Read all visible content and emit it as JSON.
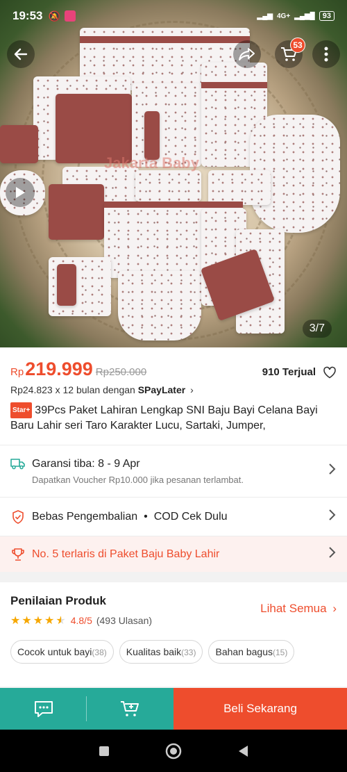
{
  "status_bar": {
    "time": "19:53",
    "battery": "93",
    "network": "4G+"
  },
  "product_image": {
    "counter": "3/7",
    "watermark": "Jakarta Baby"
  },
  "cart": {
    "badge_count": "53"
  },
  "price": {
    "currency": "Rp",
    "current": "219.999",
    "original": "Rp250.000",
    "sold": "910 Terjual",
    "paylater": "Rp24.823 x 12 bulan dengan",
    "paylater_brand": "SPayLater"
  },
  "title": {
    "badge": "Star+",
    "text": "39Pcs Paket Lahiran Lengkap SNI Baju Bayi Celana Bayi Baru Lahir seri Taro Karakter Lucu, Sartaki, Jumper,"
  },
  "shipping": {
    "label": "Garansi tiba: 8 - 9 Apr",
    "sub": "Dapatkan Voucher Rp10.000 jika pesanan terlambat."
  },
  "returns": {
    "label": "Bebas Pengembalian",
    "separator": "•",
    "cod": "COD Cek Dulu"
  },
  "bestseller": {
    "label": "No. 5 terlaris di Paket Baju Baby Lahir"
  },
  "reviews": {
    "title": "Penilaian Produk",
    "rating": "4.8/5",
    "count": "(493 Ulasan)",
    "see_all": "Lihat Semua",
    "tags": [
      {
        "label": "Cocok untuk bayi",
        "count": "(38)"
      },
      {
        "label": "Kualitas baik",
        "count": "(33)"
      },
      {
        "label": "Bahan bagus",
        "count": "(15)"
      }
    ]
  },
  "actions": {
    "buy_now": "Beli Sekarang"
  },
  "colors": {
    "accent": "#ee4d2d",
    "teal": "#26aa99",
    "star": "#f6a700"
  }
}
